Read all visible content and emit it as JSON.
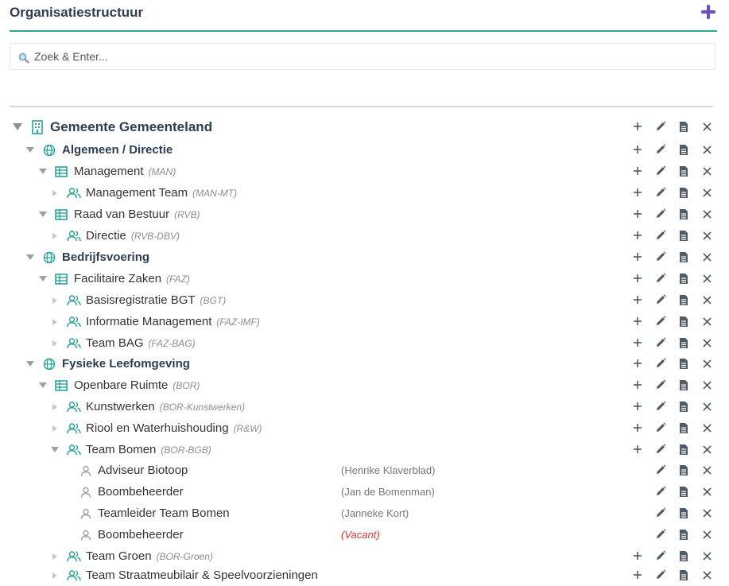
{
  "header": {
    "title": "Organisatiestructuur",
    "add_icon": "plus-icon",
    "accent": "#6a4fc8"
  },
  "search": {
    "placeholder": "Zoek & Enter...",
    "value": "",
    "icon": "search-icon"
  },
  "colors": {
    "teal": "#2aa59a",
    "vacant": "#d9342b"
  },
  "tree": [
    {
      "level": 0,
      "type": "root",
      "toggle": "down",
      "label": "Gemeente Gemeenteland",
      "code": "",
      "person": "",
      "add": true
    },
    {
      "level": 1,
      "type": "directie",
      "toggle": "down",
      "label": "Algemeen / Directie",
      "code": "",
      "person": "",
      "add": true
    },
    {
      "level": 2,
      "type": "afdeling",
      "toggle": "down",
      "label": "Management",
      "code": "(MAN)",
      "person": "",
      "add": true
    },
    {
      "level": 3,
      "type": "team",
      "toggle": "right",
      "label": "Management Team",
      "code": "(MAN-MT)",
      "person": "",
      "add": true
    },
    {
      "level": 2,
      "type": "afdeling",
      "toggle": "down",
      "label": "Raad van Bestuur",
      "code": "(RVB)",
      "person": "",
      "add": true
    },
    {
      "level": 3,
      "type": "team",
      "toggle": "right",
      "label": "Directie",
      "code": "(RVB-DBV)",
      "person": "",
      "add": true
    },
    {
      "level": 1,
      "type": "directie",
      "toggle": "down",
      "label": "Bedrijfsvoering",
      "code": "",
      "person": "",
      "add": true
    },
    {
      "level": 2,
      "type": "afdeling",
      "toggle": "down",
      "label": "Facilitaire Zaken",
      "code": "(FAZ)",
      "person": "",
      "add": true
    },
    {
      "level": 3,
      "type": "team",
      "toggle": "right",
      "label": "Basisregistratie BGT",
      "code": "(BGT)",
      "person": "",
      "add": true
    },
    {
      "level": 3,
      "type": "team",
      "toggle": "right",
      "label": "Informatie Management",
      "code": "(FAZ-IMF)",
      "person": "",
      "add": true
    },
    {
      "level": 3,
      "type": "team",
      "toggle": "right",
      "label": "Team BAG",
      "code": "(FAZ-BAG)",
      "person": "",
      "add": true
    },
    {
      "level": 1,
      "type": "directie",
      "toggle": "down",
      "label": "Fysieke Leefomgeving",
      "code": "",
      "person": "",
      "add": true
    },
    {
      "level": 2,
      "type": "afdeling",
      "toggle": "down",
      "label": "Openbare Ruimte",
      "code": "(BOR)",
      "person": "",
      "add": true
    },
    {
      "level": 3,
      "type": "team",
      "toggle": "right",
      "label": "Kunstwerken",
      "code": "(BOR-Kunstwerken)",
      "person": "",
      "add": true
    },
    {
      "level": 3,
      "type": "team",
      "toggle": "right",
      "label": "Riool en Waterhuishouding",
      "code": "(R&W)",
      "person": "",
      "add": true
    },
    {
      "level": 3,
      "type": "team",
      "toggle": "down",
      "label": "Team Bomen",
      "code": "(BOR-BGB)",
      "person": "",
      "add": true
    },
    {
      "level": 4,
      "type": "functie",
      "toggle": "none",
      "label": "Adviseur Biotoop",
      "code": "",
      "person": "(Henrike Klaverblad)",
      "vacant": false,
      "add": false
    },
    {
      "level": 4,
      "type": "functie",
      "toggle": "none",
      "label": "Boombeheerder",
      "code": "",
      "person": "(Jan de Bomenman)",
      "vacant": false,
      "add": false
    },
    {
      "level": 4,
      "type": "functie",
      "toggle": "none",
      "label": "Teamleider Team Bomen",
      "code": "",
      "person": "(Janneke Kort)",
      "vacant": false,
      "add": false
    },
    {
      "level": 4,
      "type": "functie",
      "toggle": "none",
      "label": "Boombeheerder",
      "code": "",
      "person": "(Vacant)",
      "vacant": true,
      "add": false
    },
    {
      "level": 3,
      "type": "team",
      "toggle": "right",
      "label": "Team Groen",
      "code": "(BOR-Groen)",
      "person": "",
      "add": true
    },
    {
      "level": 3,
      "type": "team",
      "toggle": "right",
      "label": "Team Straatmeubilair & Speelvoorzieningen",
      "code": "",
      "person": "",
      "add": true
    }
  ]
}
